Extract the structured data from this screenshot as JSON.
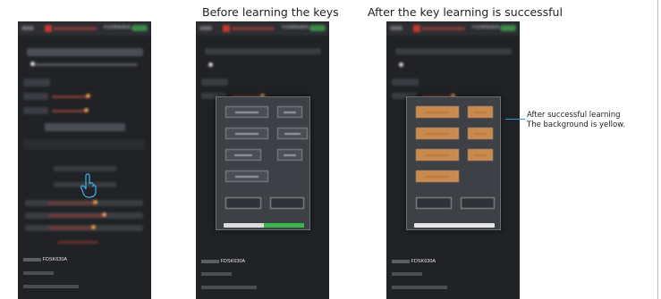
{
  "captions": {
    "before": "Before learning the keys",
    "after": "After the key learning is successful"
  },
  "callout": {
    "line1": "After successful learning",
    "line2": "The background is yellow."
  },
  "phones": [
    {
      "model": "FDSK630A",
      "footer": [
        "FDSK630A",
        "",
        ""
      ]
    },
    {
      "model": "FDSK630A",
      "footer": [
        "FDSK630A",
        "",
        ""
      ]
    },
    {
      "model": "FDSK630A",
      "footer": [
        "FDSK630A",
        "",
        ""
      ]
    }
  ],
  "colors": {
    "learned_key": "#c9894d",
    "progress_green": "#3bb44a",
    "callout_line": "#2d9bd6"
  },
  "learning_progress": 0.5
}
